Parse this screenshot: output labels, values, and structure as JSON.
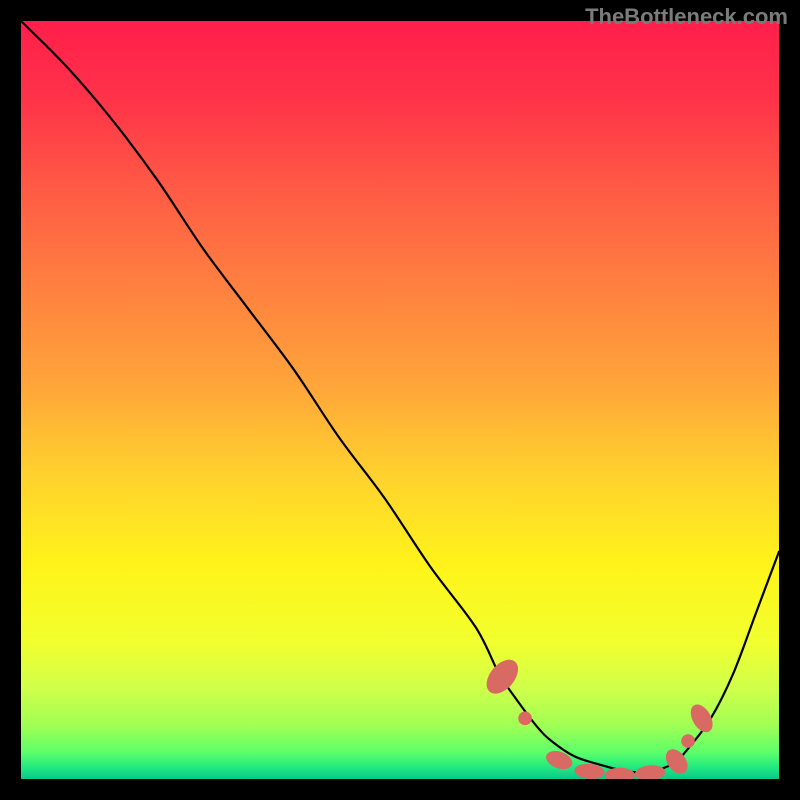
{
  "attribution": "TheBottleneck.com",
  "chart_data": {
    "type": "line",
    "title": "",
    "xlabel": "",
    "ylabel": "",
    "xlim": [
      0,
      100
    ],
    "ylim": [
      0,
      100
    ],
    "series": [
      {
        "name": "bottleneck-curve",
        "x": [
          0,
          6,
          12,
          18,
          24,
          30,
          36,
          42,
          48,
          54,
          60,
          63,
          65,
          68,
          70,
          73,
          76,
          80,
          83,
          86,
          88,
          91,
          94,
          97,
          100
        ],
        "y": [
          100,
          94,
          87,
          79,
          70,
          62,
          54,
          45,
          37,
          28,
          20,
          14,
          11,
          7,
          5,
          3,
          2,
          1,
          1,
          2,
          4,
          8,
          14,
          22,
          30
        ]
      }
    ],
    "markers": {
      "name": "highlight-dots",
      "color": "#d86a63",
      "points": [
        {
          "x": 63.5,
          "y": 13.5,
          "rx": 1.6,
          "ry": 2.6,
          "rot": 40
        },
        {
          "x": 66.5,
          "y": 8.0,
          "rx": 0.9,
          "ry": 0.9,
          "rot": 0
        },
        {
          "x": 71.0,
          "y": 2.5,
          "rx": 1.8,
          "ry": 1.1,
          "rot": 20
        },
        {
          "x": 75.0,
          "y": 1.0,
          "rx": 2.0,
          "ry": 1.0,
          "rot": 5
        },
        {
          "x": 79.0,
          "y": 0.5,
          "rx": 2.0,
          "ry": 1.0,
          "rot": 0
        },
        {
          "x": 83.0,
          "y": 0.8,
          "rx": 2.0,
          "ry": 1.0,
          "rot": -5
        },
        {
          "x": 86.5,
          "y": 2.3,
          "rx": 1.2,
          "ry": 1.8,
          "rot": -35
        },
        {
          "x": 88.0,
          "y": 5.0,
          "rx": 0.9,
          "ry": 0.9,
          "rot": 0
        },
        {
          "x": 89.8,
          "y": 8.0,
          "rx": 1.2,
          "ry": 2.0,
          "rot": -30
        }
      ]
    },
    "gradient_stops": [
      {
        "offset": 0.0,
        "color": "#ff1e4b"
      },
      {
        "offset": 0.1,
        "color": "#ff3249"
      },
      {
        "offset": 0.22,
        "color": "#ff5a45"
      },
      {
        "offset": 0.35,
        "color": "#ff8040"
      },
      {
        "offset": 0.48,
        "color": "#ffa53a"
      },
      {
        "offset": 0.6,
        "color": "#ffd22e"
      },
      {
        "offset": 0.72,
        "color": "#fff41a"
      },
      {
        "offset": 0.82,
        "color": "#f1ff2e"
      },
      {
        "offset": 0.88,
        "color": "#d0ff4a"
      },
      {
        "offset": 0.93,
        "color": "#a0ff54"
      },
      {
        "offset": 0.965,
        "color": "#5cff6a"
      },
      {
        "offset": 0.985,
        "color": "#20e880"
      },
      {
        "offset": 1.0,
        "color": "#08c98a"
      }
    ]
  }
}
